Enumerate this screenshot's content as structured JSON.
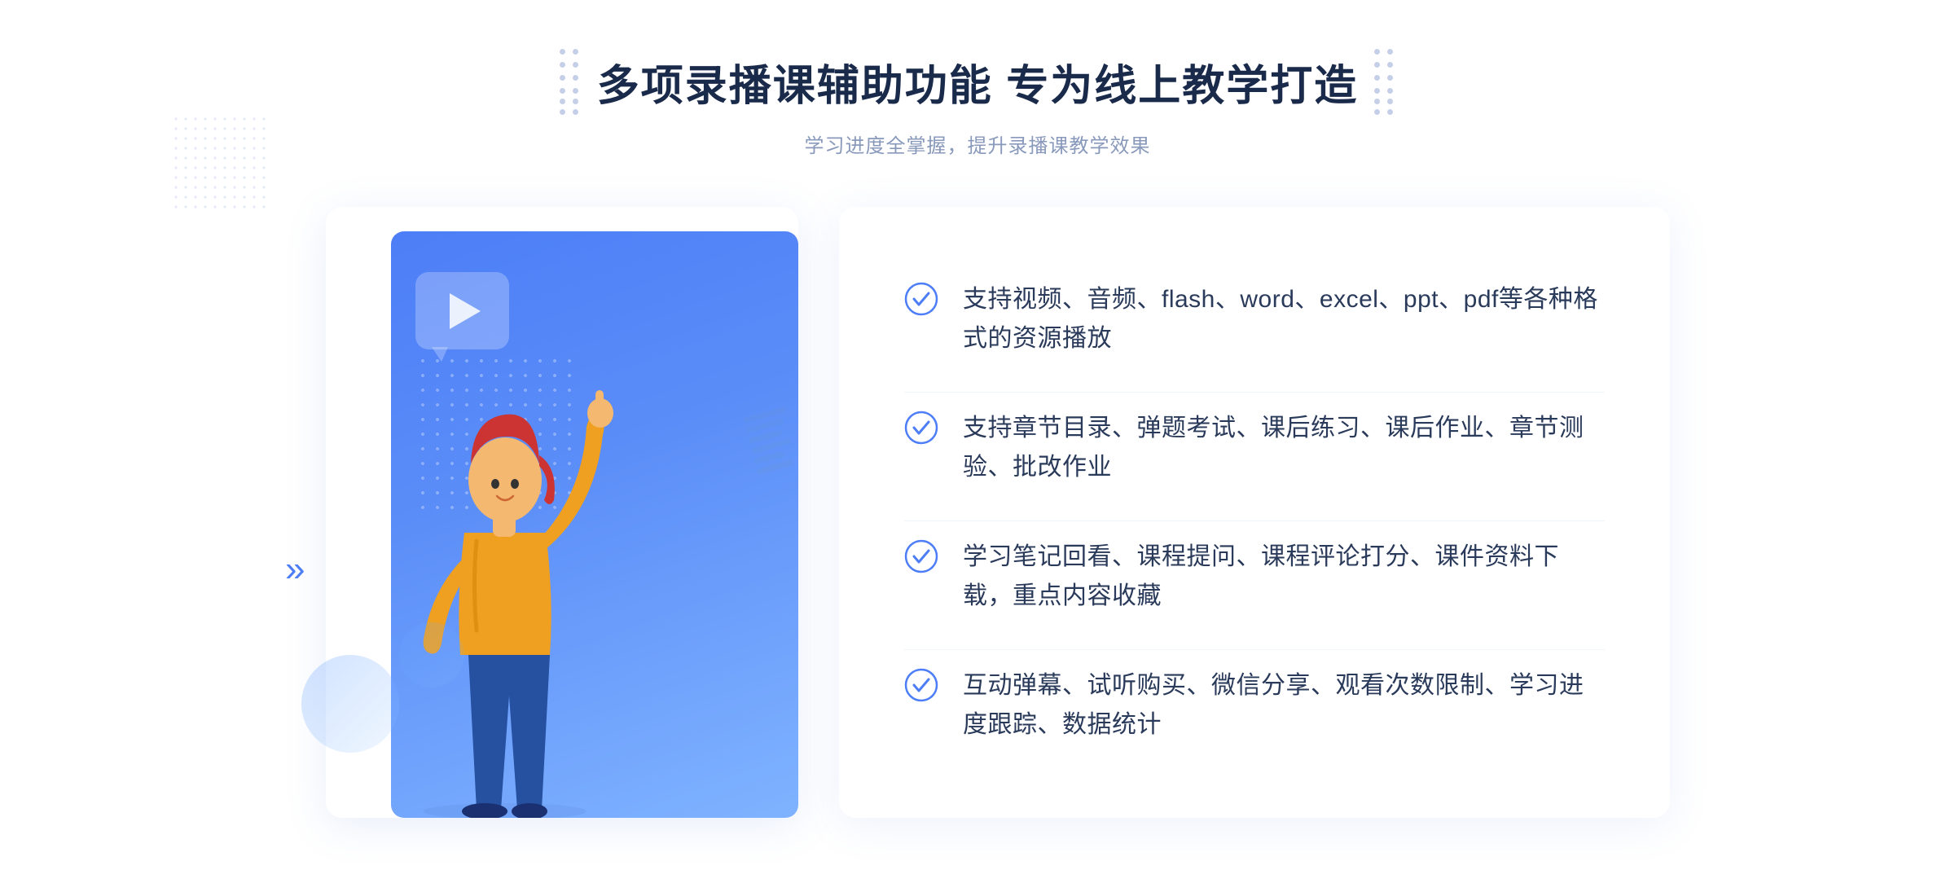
{
  "header": {
    "title": "多项录播课辅助功能 专为线上教学打造",
    "subtitle": "学习进度全掌握，提升录播课教学效果"
  },
  "features": [
    {
      "id": "feature-1",
      "text": "支持视频、音频、flash、word、excel、ppt、pdf等各种格式的资源播放"
    },
    {
      "id": "feature-2",
      "text": "支持章节目录、弹题考试、课后练习、课后作业、章节测验、批改作业"
    },
    {
      "id": "feature-3",
      "text": "学习笔记回看、课程提问、课程评论打分、课件资料下载，重点内容收藏"
    },
    {
      "id": "feature-4",
      "text": "互动弹幕、试听购买、微信分享、观看次数限制、学习进度跟踪、数据统计"
    }
  ],
  "colors": {
    "primary_blue": "#4d7ef7",
    "light_blue": "#7fb3ff",
    "text_dark": "#1a2a4a",
    "text_medium": "#2a3a5a",
    "text_light": "#8899bb",
    "check_color": "#4d7ef7",
    "dot_color": "#c5d5f0"
  },
  "icons": {
    "check": "check-circle",
    "play": "play-triangle",
    "arrows_left": "»",
    "arrows_right": "«"
  }
}
